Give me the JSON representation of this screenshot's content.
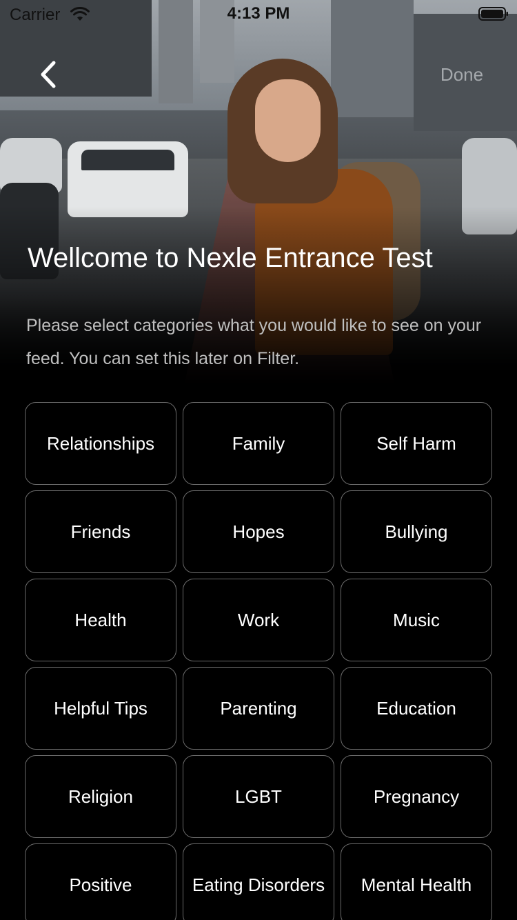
{
  "status_bar": {
    "carrier": "Carrier",
    "time": "4:13 PM",
    "wifi_icon": "wifi-icon",
    "battery_icon": "battery-icon"
  },
  "nav": {
    "back_icon": "chevron-left-icon",
    "done_label": "Done"
  },
  "hero": {
    "image": "woman-with-backpack-city-street-photo"
  },
  "header": {
    "title": "Wellcome to Nexle Entrance Test",
    "subtitle": "Please select categories what you would like to see on your feed. You can set this later on Filter."
  },
  "categories": [
    "Relationships",
    "Family",
    "Self Harm",
    "Friends",
    "Hopes",
    "Bullying",
    "Health",
    "Work",
    "Music",
    "Helpful Tips",
    "Parenting",
    "Education",
    "Religion",
    "LGBT",
    "Pregnancy",
    "Positive",
    "Eating Disorders",
    "Mental Health"
  ],
  "colors": {
    "background": "#000000",
    "chip_border": "#6b6b6b",
    "done_text": "#a5a9ad",
    "subtitle_text": "#bfbfbf"
  }
}
